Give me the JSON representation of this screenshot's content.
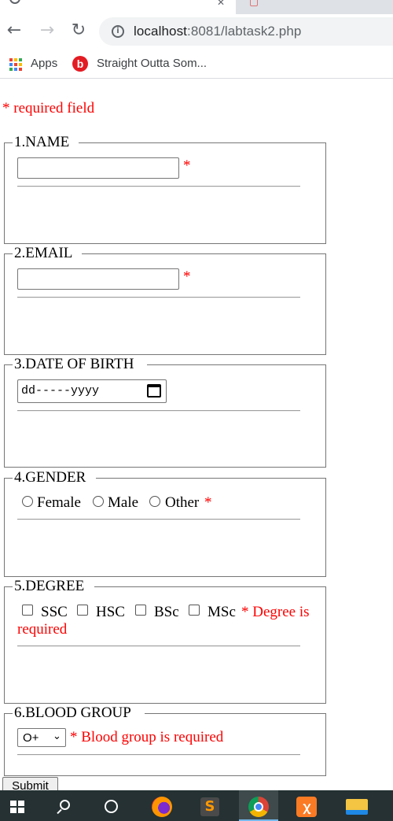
{
  "browser": {
    "url_host": "localhost",
    "url_path": ":8081/labtask2.php",
    "bookmarks": [
      {
        "label": "Apps"
      },
      {
        "label": "Straight Outta Som..."
      }
    ],
    "apps_colors": [
      "#ea4335",
      "#fbbc05",
      "#34a853",
      "#4285f4",
      "#ea4335",
      "#fbbc05",
      "#34a853",
      "#4285f4",
      "#ea4335"
    ]
  },
  "page": {
    "required_note": "* required field",
    "sections": {
      "name": {
        "legend": "1.NAME",
        "star": "*",
        "value": ""
      },
      "email": {
        "legend": "2.EMAIL",
        "star": "*",
        "value": ""
      },
      "dob": {
        "legend": "3.DATE OF BIRTH",
        "placeholder": "dd-----yyyy"
      },
      "gender": {
        "legend": "4.GENDER",
        "options": [
          "Female",
          "Male",
          "Other"
        ],
        "star": "*"
      },
      "degree": {
        "legend": "5.DEGREE",
        "options": [
          "SSC",
          "HSC",
          "BSc",
          "MSc"
        ],
        "error_line1": "* Degree is",
        "error_line2": "required"
      },
      "blood": {
        "legend": "6.BLOOD GROUP",
        "selected": "O+",
        "error": "* Blood group is required"
      }
    },
    "submit_label": "Submit"
  },
  "colors": {
    "error": "#ff0000",
    "border": "#767676",
    "taskbar": "#253133"
  },
  "taskbar": {
    "icons": [
      "windows-start-icon",
      "search-icon",
      "cortana-icon",
      "firefox-icon",
      "sublime-text-icon",
      "chrome-icon",
      "xampp-icon",
      "file-explorer-icon"
    ]
  }
}
